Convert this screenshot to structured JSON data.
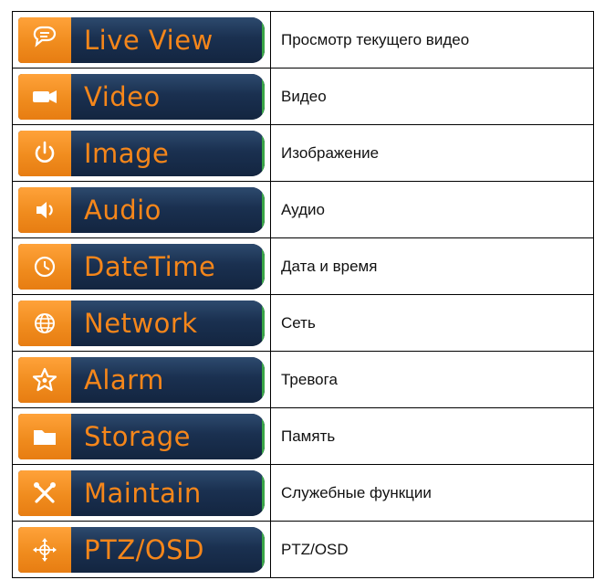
{
  "rows": [
    {
      "button_label": "Live View",
      "icon": "chat-bubble-icon",
      "description": "Просмотр текущего видео"
    },
    {
      "button_label": "Video",
      "icon": "camera-icon",
      "description": "Видео"
    },
    {
      "button_label": "Image",
      "icon": "power-icon",
      "description": "Изображение"
    },
    {
      "button_label": "Audio",
      "icon": "speaker-icon",
      "description": "Аудио"
    },
    {
      "button_label": "DateTime",
      "icon": "clock-icon",
      "description": "Дата и время"
    },
    {
      "button_label": "Network",
      "icon": "globe-icon",
      "description": "Сеть"
    },
    {
      "button_label": "Alarm",
      "icon": "star-icon",
      "description": "Тревога"
    },
    {
      "button_label": "Storage",
      "icon": "folder-icon",
      "description": "Память"
    },
    {
      "button_label": "Maintain",
      "icon": "tools-icon",
      "description": "Служебные функции"
    },
    {
      "button_label": "PTZ/OSD",
      "icon": "ptz-arrows-icon",
      "description": "PTZ/OSD"
    }
  ],
  "colors": {
    "icon_bg": "#f08c1e",
    "button_bg": "#1a3050",
    "label_text": "#f5861a",
    "edge_green": "#3aa547"
  }
}
